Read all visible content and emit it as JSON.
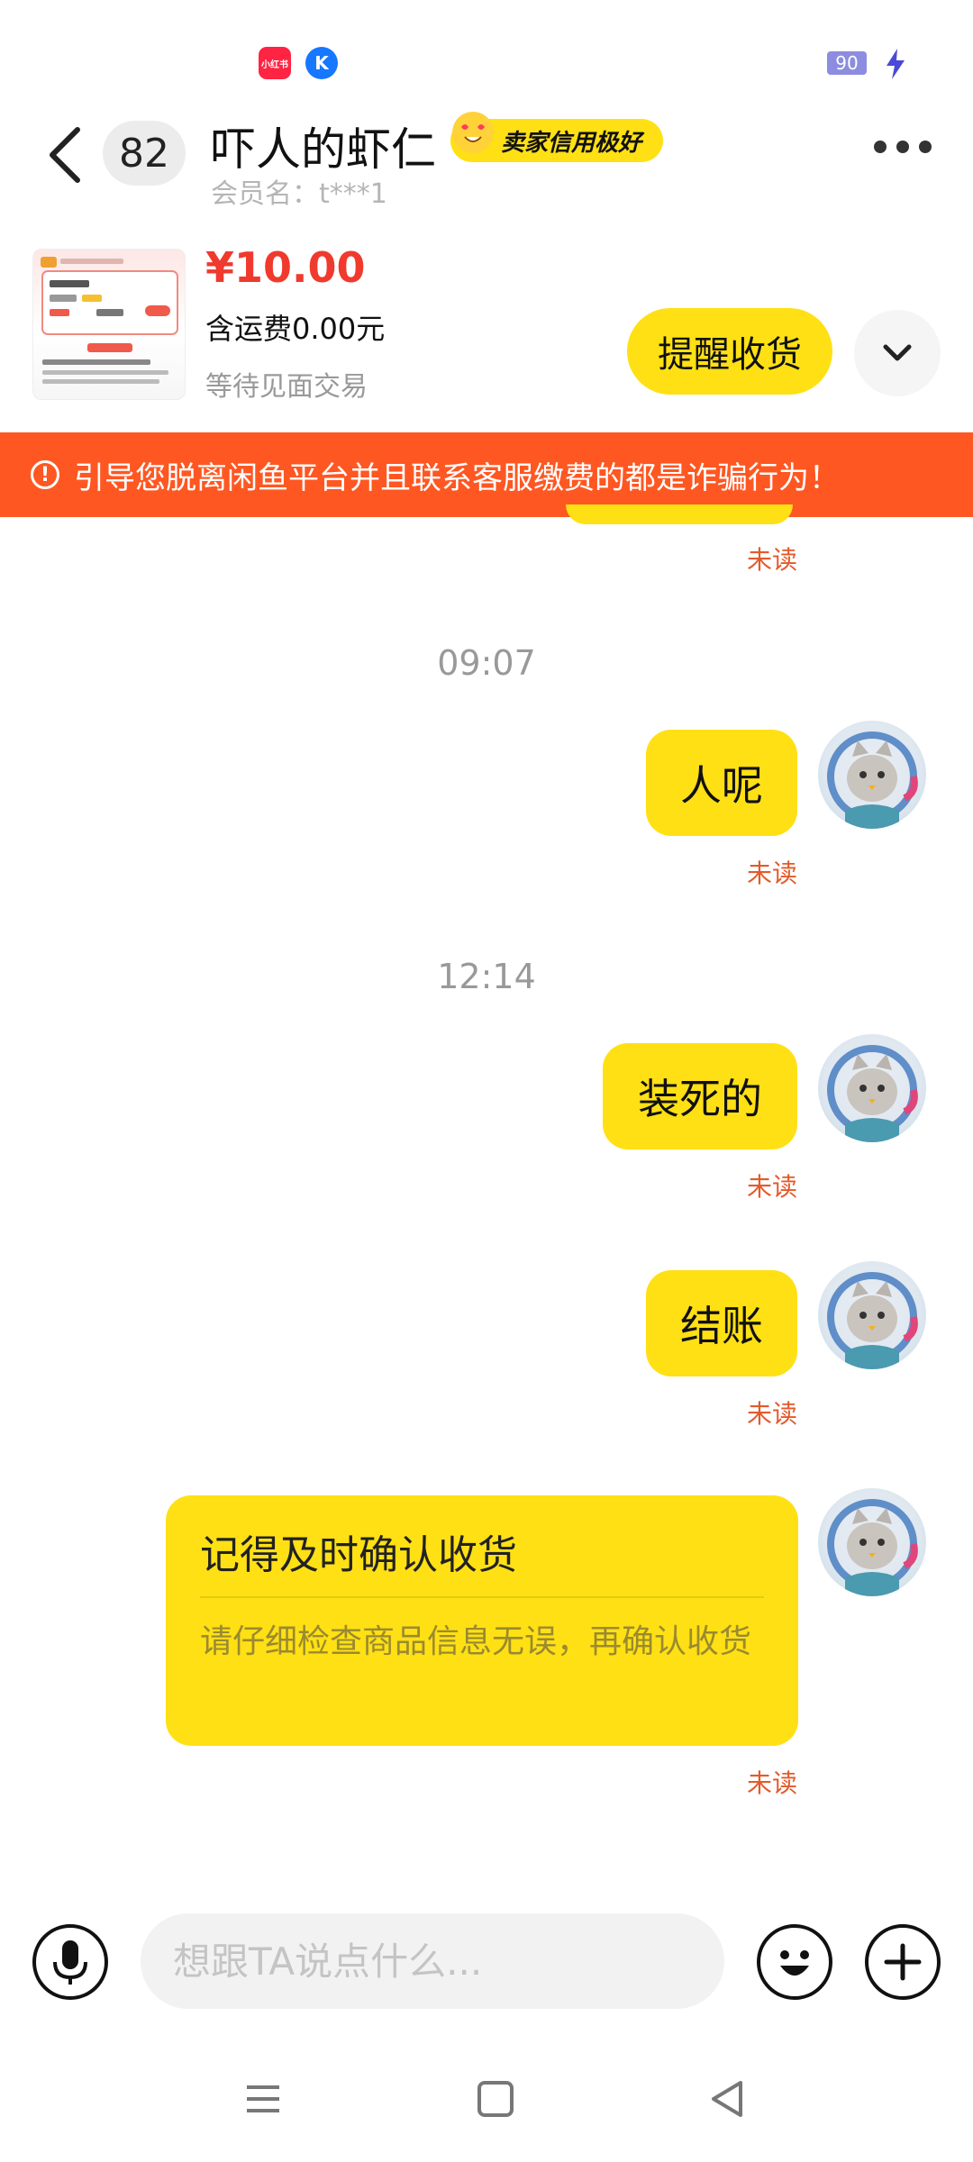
{
  "status_bar": {
    "app_icons": [
      {
        "name": "xiaohongshu-icon",
        "label": "小红书",
        "color": "#ff2442"
      },
      {
        "name": "k-app-icon",
        "label": "K",
        "color": "#1677ff"
      }
    ],
    "battery": "90",
    "charging_icon": "lightning-icon"
  },
  "header": {
    "back_icon": "chevron-left-icon",
    "unread_count": "82",
    "title": "吓人的虾仁",
    "credit_badge": "卖家信用极好",
    "member_name": "会员名：t***1",
    "more_icon": "more-icon"
  },
  "product": {
    "price": "¥10.00",
    "shipping": "含运费0.00元",
    "status": "等待见面交易",
    "remind_button": "提醒收货",
    "expand_icon": "chevron-down-icon"
  },
  "warning_banner": {
    "icon": "alert-circle-icon",
    "text": "引导您脱离闲鱼平台并且联系客服缴费的都是诈骗行为！",
    "color": "#ff5722"
  },
  "chat": {
    "accent": "#ffe014",
    "unread_label": "未读",
    "messages": [
      {
        "time": "09:07",
        "text": "人呢",
        "status": "未读"
      },
      {
        "time": "12:14",
        "text": "装死的",
        "status": "未读"
      },
      {
        "time": "",
        "text": "结账",
        "status": "未读"
      }
    ],
    "top_status": "未读",
    "card": {
      "title": "记得及时确认收货",
      "body": "请仔细检查商品信息无误，再确认收货",
      "status": "未读"
    }
  },
  "input_bar": {
    "mic_icon": "microphone-icon",
    "placeholder": "想跟TA说点什么...",
    "emoji_icon": "emoji-icon",
    "plus_icon": "plus-icon"
  },
  "nav_bar": {
    "menu_icon": "menu-icon",
    "home_icon": "home-square-icon",
    "back_icon": "back-triangle-icon"
  }
}
